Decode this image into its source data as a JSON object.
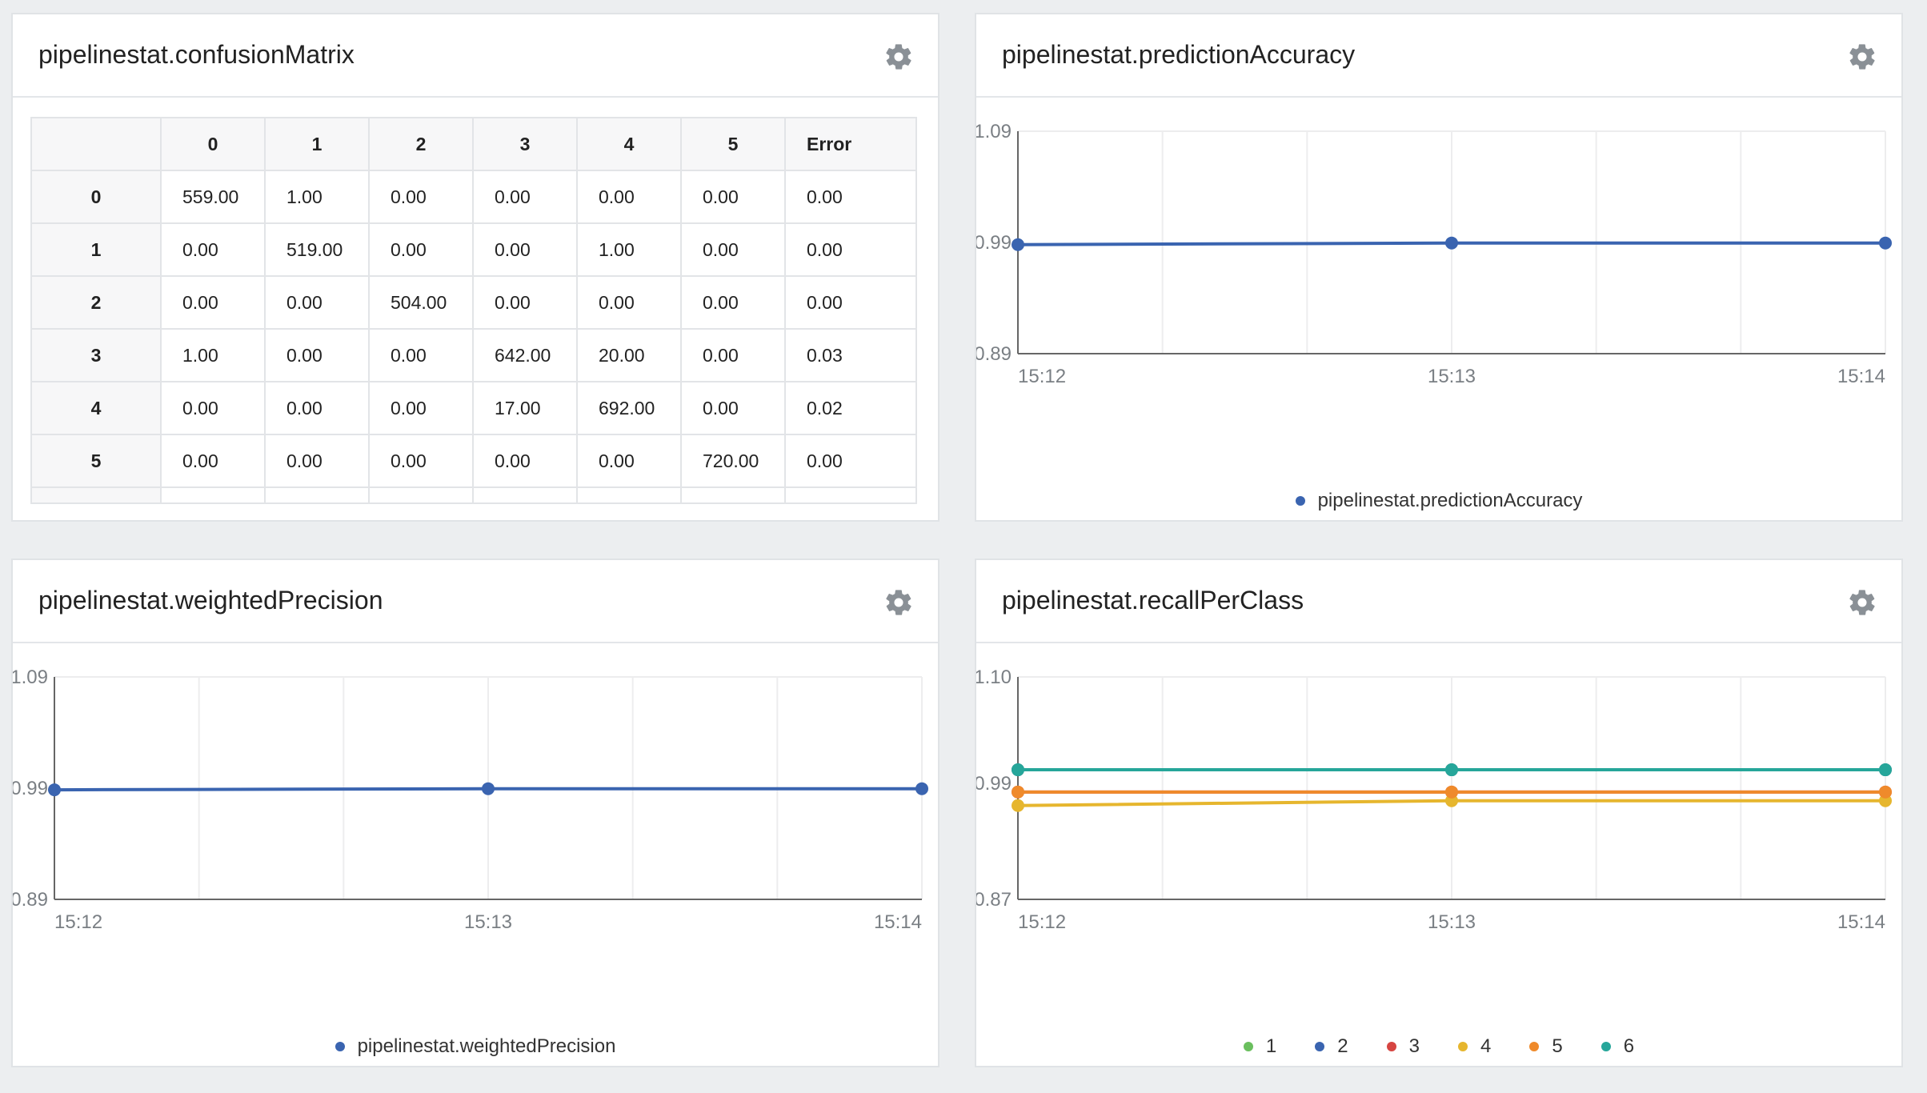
{
  "panels": {
    "confusion": {
      "title": "pipelinestat.confusionMatrix",
      "columns": [
        "",
        "0",
        "1",
        "2",
        "3",
        "4",
        "5",
        "Error"
      ],
      "rows": [
        {
          "label": "0",
          "cells": [
            "559.00",
            "1.00",
            "0.00",
            "0.00",
            "0.00",
            "0.00",
            "0.00"
          ]
        },
        {
          "label": "1",
          "cells": [
            "0.00",
            "519.00",
            "0.00",
            "0.00",
            "1.00",
            "0.00",
            "0.00"
          ]
        },
        {
          "label": "2",
          "cells": [
            "0.00",
            "0.00",
            "504.00",
            "0.00",
            "0.00",
            "0.00",
            "0.00"
          ]
        },
        {
          "label": "3",
          "cells": [
            "1.00",
            "0.00",
            "0.00",
            "642.00",
            "20.00",
            "0.00",
            "0.03"
          ]
        },
        {
          "label": "4",
          "cells": [
            "0.00",
            "0.00",
            "0.00",
            "17.00",
            "692.00",
            "0.00",
            "0.02"
          ]
        },
        {
          "label": "5",
          "cells": [
            "0.00",
            "0.00",
            "0.00",
            "0.00",
            "0.00",
            "720.00",
            "0.00"
          ]
        }
      ]
    },
    "accuracy": {
      "title": "pipelinestat.predictionAccuracy"
    },
    "precision": {
      "title": "pipelinestat.weightedPrecision"
    },
    "recall": {
      "title": "pipelinestat.recallPerClass"
    }
  },
  "icons": {
    "settings": "gear-icon"
  },
  "chart_data": [
    {
      "id": "accuracy",
      "type": "line",
      "x": [
        "15:12",
        "15:13",
        "15:14"
      ],
      "ylim": [
        0.89,
        1.09
      ],
      "yticks": [
        "1.09",
        "0.99",
        "0.89"
      ],
      "ytick_values": [
        1.09,
        0.99,
        0.89
      ],
      "grid": true,
      "legend": "bottom-center",
      "series": [
        {
          "name": "pipelinestat.predictionAccuracy",
          "color": "#3a64b0",
          "values": [
            0.988,
            0.9895,
            0.9895
          ]
        }
      ]
    },
    {
      "id": "precision",
      "type": "line",
      "x": [
        "15:12",
        "15:13",
        "15:14"
      ],
      "ylim": [
        0.89,
        1.09
      ],
      "yticks": [
        "1.09",
        "0.99",
        "0.89"
      ],
      "ytick_values": [
        1.09,
        0.99,
        0.89
      ],
      "grid": true,
      "legend": "bottom-center",
      "series": [
        {
          "name": "pipelinestat.weightedPrecision",
          "color": "#3a64b0",
          "values": [
            0.9885,
            0.9895,
            0.9895
          ]
        }
      ]
    },
    {
      "id": "recall",
      "type": "line",
      "x": [
        "15:12",
        "15:13",
        "15:14"
      ],
      "ylim": [
        0.87,
        1.1
      ],
      "yticks": [
        "1.10",
        "0.99",
        "0.87"
      ],
      "ytick_values": [
        1.1,
        0.99,
        0.87
      ],
      "grid": true,
      "legend": "bottom-center",
      "series": [
        {
          "name": "1",
          "color": "#6abf5e",
          "values": [
            1.004,
            1.004,
            1.004
          ]
        },
        {
          "name": "2",
          "color": "#3a64b0",
          "values": [
            1.004,
            1.004,
            1.004
          ]
        },
        {
          "name": "3",
          "color": "#d64541",
          "values": [
            0.981,
            0.981,
            0.981
          ]
        },
        {
          "name": "4",
          "color": "#e6b62e",
          "values": [
            0.967,
            0.972,
            0.972
          ]
        },
        {
          "name": "5",
          "color": "#ef8a2b",
          "values": [
            0.981,
            0.981,
            0.981
          ]
        },
        {
          "name": "6",
          "color": "#26a69a",
          "values": [
            1.004,
            1.004,
            1.004
          ]
        }
      ]
    }
  ]
}
